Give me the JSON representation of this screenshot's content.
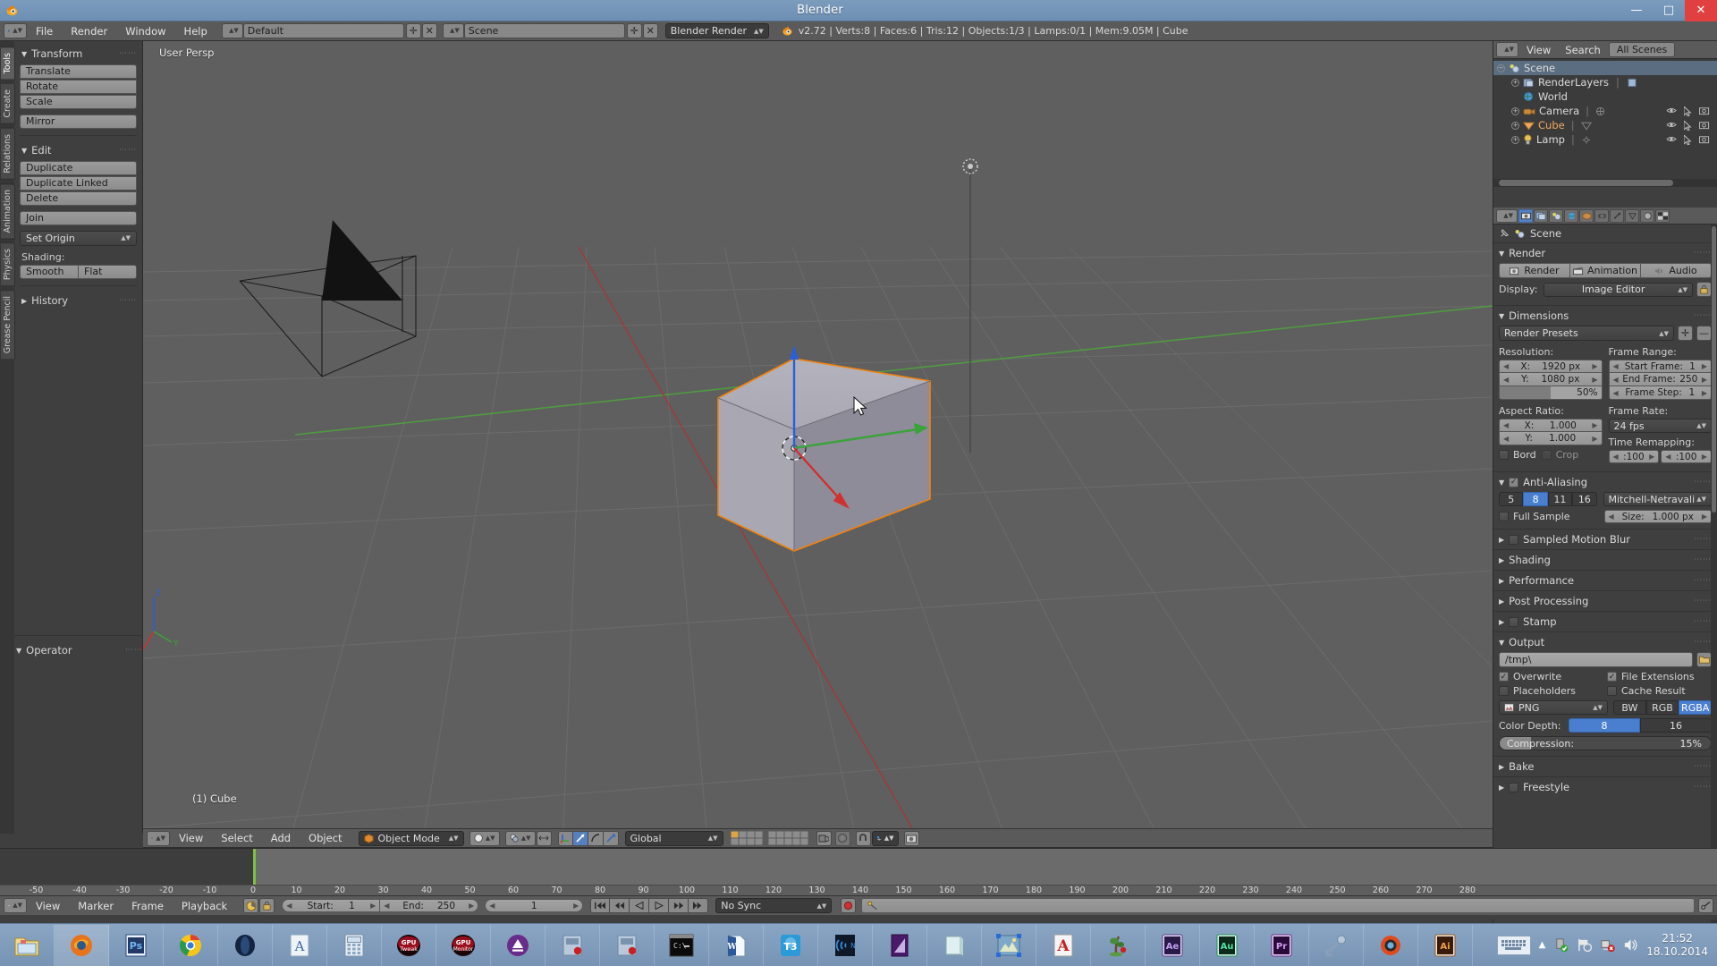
{
  "window": {
    "title": "Blender",
    "minimize": "—",
    "maximize": "□",
    "close": "✕",
    "app_icon": "blender-logo-icon"
  },
  "infobar": {
    "editor_icon": "info-editor-icon",
    "menus": [
      "File",
      "Render",
      "Window",
      "Help"
    ],
    "screen_layout": {
      "icon": "screen-layout-icon",
      "value": "Default",
      "add": "✛",
      "remove": "✕"
    },
    "scene": {
      "icon": "scene-icon",
      "value": "Scene",
      "add": "✛",
      "remove": "✕"
    },
    "render_engine": "Blender Render",
    "stats": "v2.72 | Verts:8 | Faces:6 | Tris:12 | Objects:1/3 | Lamps:0/1 | Mem:9.05M | Cube"
  },
  "toolshelf": {
    "tabs": [
      "Tools",
      "Create",
      "Relations",
      "Animation",
      "Physics",
      "Grease Pencil"
    ],
    "active_tab": "Tools",
    "sections": [
      {
        "title": "Transform",
        "groups": [
          [
            "Translate",
            "Rotate",
            "Scale"
          ],
          [
            "Mirror"
          ]
        ]
      },
      {
        "title": "Edit",
        "groups": [
          [
            "Duplicate",
            "Duplicate Linked",
            "Delete"
          ],
          [
            "Join"
          ]
        ],
        "dropdown": "Set Origin",
        "shading_label": "Shading:",
        "shading_options": [
          "Smooth",
          "Flat"
        ]
      },
      {
        "title": "History",
        "collapsed": true
      }
    ],
    "operator_panel": "Operator"
  },
  "viewport": {
    "view_label": "User Persp",
    "object_label": "(1) Cube",
    "axis_x": "X",
    "axis_y": "Y",
    "axis_z": "Z",
    "grid_color": "#6e6e6e",
    "background_color": "#5f5f5f",
    "header": {
      "editor_icon": "3d-view-editor-icon",
      "menus": [
        "View",
        "Select",
        "Add",
        "Object"
      ],
      "mode": "Object Mode",
      "viewport_shading": "solid-shading-icon",
      "pivot": "pivot-icon",
      "manipulator_toggle": "manipulator-icon",
      "manipulator_modes": [
        "translate-manipulator-icon",
        "rotate-manipulator-icon",
        "scale-manipulator-icon"
      ],
      "transform_orientation": "Global",
      "layers": "layer-grid",
      "snap": "snap-magnet-icon",
      "snap_target": "snap-vertex-icon",
      "render_icon": "render-camera-icon"
    }
  },
  "outliner": {
    "editor_icon": "outliner-editor-icon",
    "menus": [
      "View",
      "Search"
    ],
    "display_mode": "All Scenes",
    "rows": [
      {
        "label": "Scene",
        "indent": 0,
        "icon": "scene-icon",
        "selected": true,
        "expander": "−",
        "has_toggles": false
      },
      {
        "label": "RenderLayers",
        "indent": 1,
        "icon": "renderlayer-icon",
        "selected": false,
        "expander": "+",
        "has_toggles": false
      },
      {
        "label": "World",
        "indent": 1,
        "icon": "world-icon",
        "selected": false,
        "expander": "",
        "has_toggles": false
      },
      {
        "label": "Camera",
        "indent": 1,
        "icon": "camera-icon",
        "selected": false,
        "expander": "+",
        "has_toggles": true
      },
      {
        "label": "Cube",
        "indent": 1,
        "icon": "mesh-icon",
        "selected": false,
        "highlight": true,
        "expander": "+",
        "has_toggles": true
      },
      {
        "label": "Lamp",
        "indent": 1,
        "icon": "lamp-icon",
        "selected": false,
        "expander": "+",
        "has_toggles": true
      }
    ],
    "toggle_icons": [
      "eye-icon",
      "cursor-arrow-icon",
      "camera-render-icon"
    ]
  },
  "properties": {
    "tabs": [
      "render-tab-icon",
      "render-layers-tab-icon",
      "scene-tab-icon",
      "world-tab-icon",
      "object-tab-icon",
      "constraints-tab-icon",
      "modifiers-tab-icon",
      "data-tab-icon",
      "material-tab-icon",
      "texture-tab-icon"
    ],
    "active_tab_index": 0,
    "breadcrumb": {
      "pin_icon": "pin-icon",
      "scene_icon": "scene-icon",
      "label": "Scene"
    },
    "render": {
      "title": "Render",
      "buttons": [
        "Render",
        "Animation",
        "Audio"
      ],
      "display_label": "Display:",
      "display_value": "Image Editor",
      "display_lock_icon": "lock-icon"
    },
    "dimensions": {
      "title": "Dimensions",
      "preset": "Render Presets",
      "preset_add": "✛",
      "preset_remove": "—",
      "resolution_label": "Resolution:",
      "resolution_x": {
        "key": "X:",
        "value": "1920 px"
      },
      "resolution_y": {
        "key": "Y:",
        "value": "1080 px"
      },
      "resolution_percent": "50%",
      "frame_range_label": "Frame Range:",
      "start_frame": {
        "key": "Start Frame:",
        "value": "1"
      },
      "end_frame": {
        "key": "End Frame:",
        "value": "250"
      },
      "frame_step": {
        "key": "Frame Step:",
        "value": "1"
      },
      "aspect_label": "Aspect Ratio:",
      "aspect_x": {
        "key": "X:",
        "value": "1.000"
      },
      "aspect_y": {
        "key": "Y:",
        "value": "1.000"
      },
      "frame_rate_label": "Frame Rate:",
      "frame_rate": "24 fps",
      "time_remapping_label": "Time Remapping:",
      "remap_old": ":100",
      "remap_new": ":100",
      "border": {
        "label": "Bord",
        "checked": false
      },
      "crop": {
        "label": "Crop",
        "checked": false
      }
    },
    "antialiasing": {
      "title": "Anti-Aliasing",
      "enabled": true,
      "samples": [
        "5",
        "8",
        "11",
        "16"
      ],
      "active_sample": "8",
      "filter": "Mitchell-Netravali",
      "full_sample": {
        "label": "Full Sample",
        "checked": false
      },
      "size": {
        "key": "Size:",
        "value": "1.000 px"
      }
    },
    "collapsed_sections": [
      {
        "title": "Sampled Motion Blur",
        "has_checkbox": true
      },
      {
        "title": "Shading",
        "has_checkbox": false
      },
      {
        "title": "Performance",
        "has_checkbox": false
      },
      {
        "title": "Post Processing",
        "has_checkbox": false
      },
      {
        "title": "Stamp",
        "has_checkbox": true
      }
    ],
    "output": {
      "title": "Output",
      "path": "/tmp\\",
      "folder_icon": "folder-icon",
      "overwrite": {
        "label": "Overwrite",
        "checked": true
      },
      "file_extensions": {
        "label": "File Extensions",
        "checked": true
      },
      "placeholders": {
        "label": "Placeholders",
        "checked": false
      },
      "cache_result": {
        "label": "Cache Result",
        "checked": false
      },
      "format": "PNG",
      "format_icon": "image-file-icon",
      "channels": [
        "BW",
        "RGB",
        "RGBA"
      ],
      "active_channel": "RGBA",
      "color_depth_label": "Color Depth:",
      "color_depths": [
        "8",
        "16"
      ],
      "active_depth": "8",
      "compression_label": "Compression:",
      "compression_value": "15%",
      "compression_percent": 15
    },
    "bottom_sections": [
      {
        "title": "Bake",
        "has_checkbox": false
      },
      {
        "title": "Freestyle",
        "has_checkbox": true
      }
    ]
  },
  "timeline": {
    "editor_icon": "timeline-editor-icon",
    "menus": [
      "View",
      "Marker",
      "Frame",
      "Playback"
    ],
    "use_preview_icon": "preview-range-icon",
    "lock_icon": "lock-icon",
    "start": {
      "key": "Start:",
      "value": "1"
    },
    "end": {
      "key": "End:",
      "value": "250"
    },
    "current_frame": "1",
    "transport": [
      "jump-start-icon",
      "prev-keyframe-icon",
      "play-reverse-icon",
      "play-icon",
      "next-keyframe-icon",
      "jump-end-icon"
    ],
    "sync_mode": "No Sync",
    "record_icon": "record-icon",
    "keying_set_icon": "keying-set-icon",
    "keying_set_value": "",
    "ruler_ticks": [
      "-50",
      "-40",
      "-30",
      "-20",
      "-10",
      "0",
      "10",
      "20",
      "30",
      "40",
      "50",
      "60",
      "70",
      "80",
      "90",
      "100",
      "110",
      "120",
      "130",
      "140",
      "150",
      "160",
      "170",
      "180",
      "190",
      "200",
      "210",
      "220",
      "230",
      "240",
      "250",
      "260",
      "270",
      "280"
    ],
    "playhead_frame": 0
  },
  "taskbar": {
    "items": [
      "file-explorer-icon",
      "firefox-icon",
      "photoshop-icon",
      "chrome-icon",
      "opera-icon",
      "font-viewer-icon",
      "calculator-icon",
      "gpu-tweak-icon",
      "gpu-monitor-icon",
      "clean-icon",
      "virtual-drive-icon",
      "daemon-tools-icon",
      "command-prompt-icon",
      "word-icon",
      "teamviewer-icon",
      "wifi-analyzer-icon",
      "purple-app-icon",
      "notes-icon",
      "photo-viewer-icon",
      "acrobat-icon",
      "tree-icon",
      "after-effects-icon",
      "audition-icon",
      "premiere-icon",
      "wrench-icon",
      "camera-app-icon",
      "illustrator-icon"
    ],
    "active_index": 1,
    "tray": {
      "keyboard_icon": "onscreen-keyboard-icon",
      "show_hidden": "▲",
      "icons": [
        "usb-safely-remove-icon",
        "flag-action-center-icon",
        "network-error-icon",
        "volume-icon"
      ],
      "time": "21:52",
      "date": "18.10.2014"
    }
  },
  "colors": {
    "accent_blue": "#4a7fd0",
    "title_bar": "#7c9cbd",
    "panel_bg": "#3f3f3f",
    "header_bg": "#5a5a5a",
    "viewport_bg": "#5f5f5f",
    "selected_orange": "#f0a860",
    "playhead_green": "#7cc242",
    "close_red": "#e04040"
  }
}
